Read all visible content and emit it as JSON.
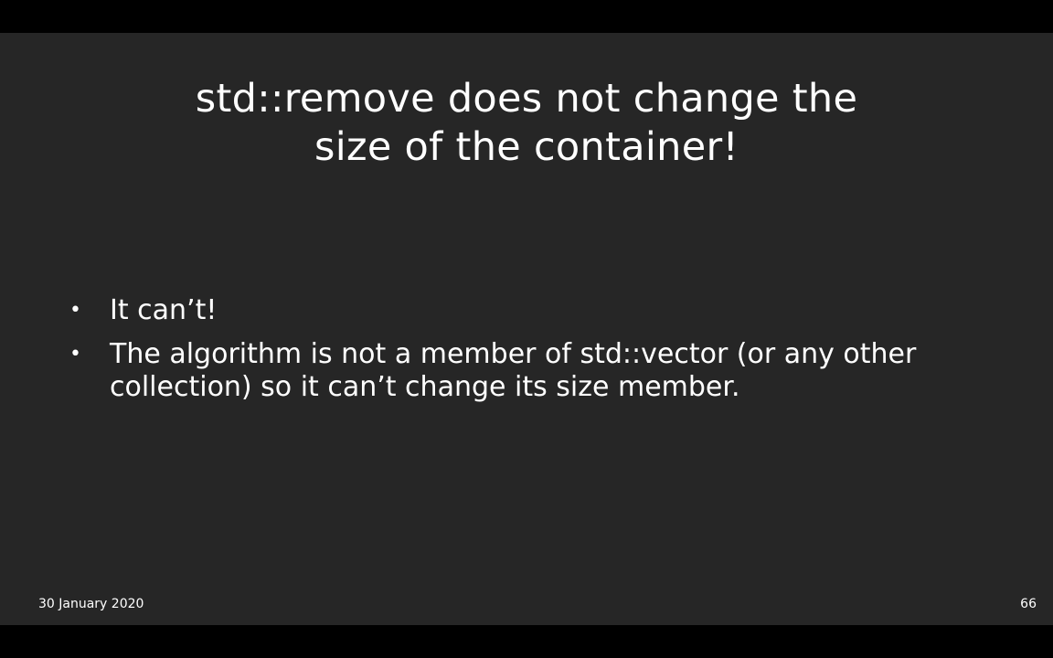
{
  "slide": {
    "title_lines": [
      "std::remove does not change the",
      "size of the container!"
    ],
    "bullets": [
      {
        "symbol": "•",
        "text": "It can’t!"
      },
      {
        "symbol": "•",
        "text": "The algorithm is not a member of std::vector (or any other collection) so it can’t change its size member."
      }
    ],
    "footer": {
      "date": "30 January 2020",
      "page_number": "66"
    }
  },
  "colors": {
    "slide_background": "#262626",
    "letterbox": "#000000",
    "text": "#ffffff"
  }
}
